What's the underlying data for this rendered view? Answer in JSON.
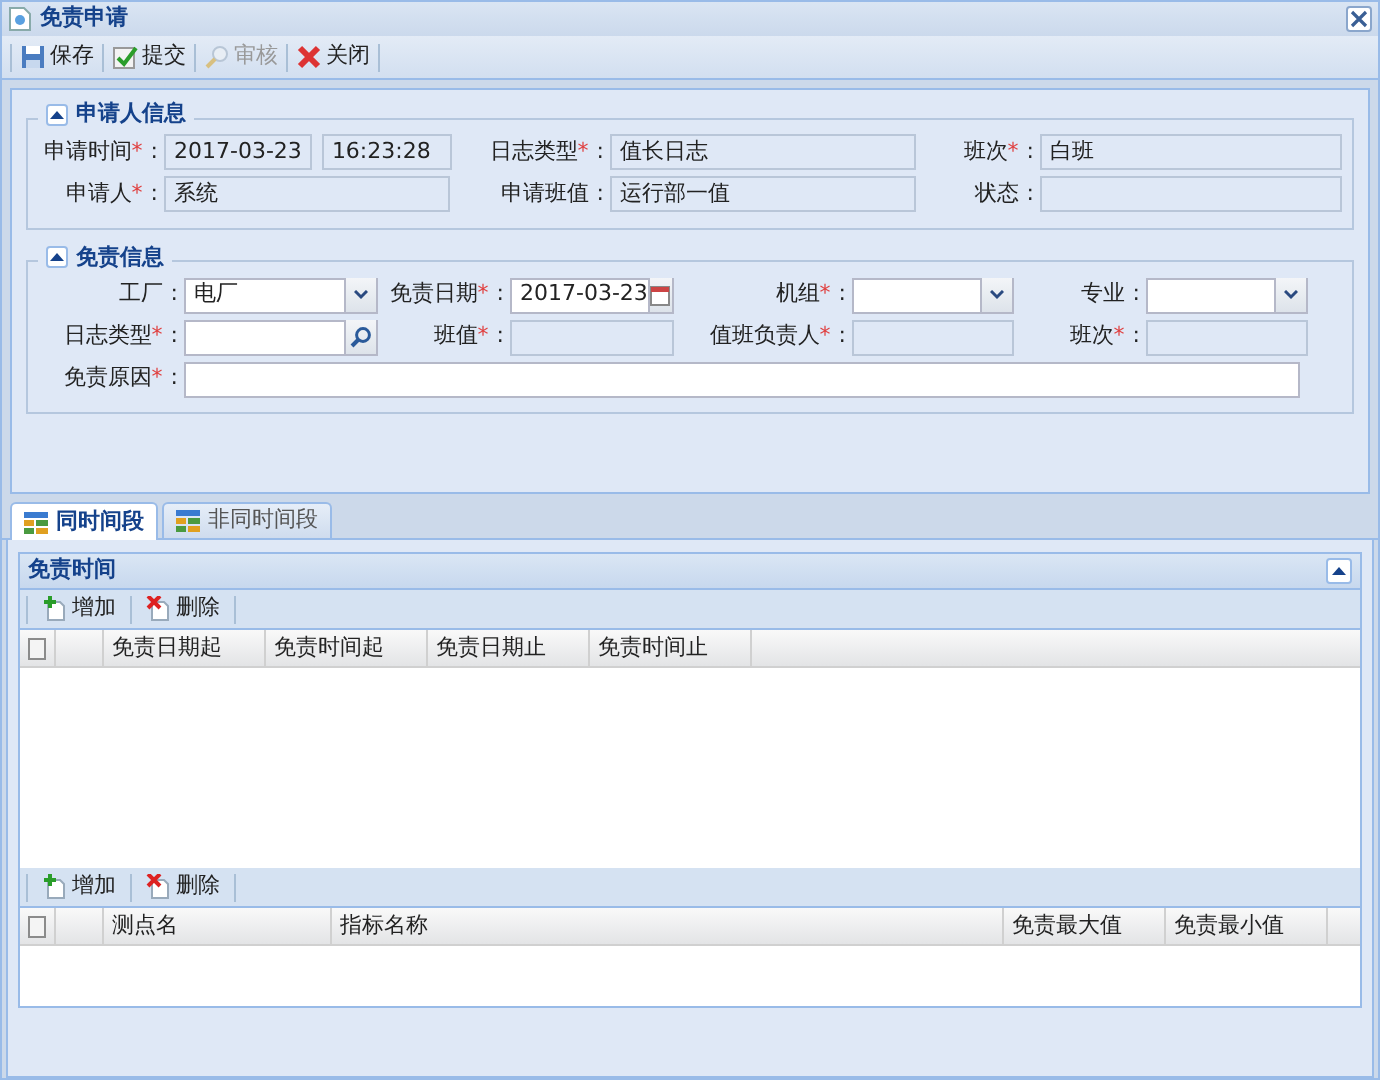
{
  "window": {
    "title": "免责申请"
  },
  "toolbar": [
    {
      "label": "保存",
      "kind": "save",
      "disabled": false
    },
    {
      "label": "提交",
      "kind": "submit",
      "disabled": false
    },
    {
      "label": "审核",
      "kind": "review",
      "disabled": true
    },
    {
      "label": "关闭",
      "kind": "close",
      "disabled": false
    }
  ],
  "applicant": {
    "title": "申请人信息",
    "rows": [
      [
        {
          "label": "申请时间",
          "star": "*",
          "colon": ":",
          "kind": "pair",
          "values": [
            "2017-03-23",
            "16:23:28"
          ],
          "readonly": true
        },
        {
          "label": "日志类型",
          "star": "*",
          "colon": ":",
          "kind": "text",
          "value": "值长日志",
          "readonly": true
        },
        {
          "label": "班次",
          "star": "*",
          "colon": ":",
          "kind": "text",
          "value": "白班",
          "readonly": true
        }
      ],
      [
        {
          "label": "申请人",
          "star": "*",
          "colon": ":",
          "kind": "text",
          "value": "系统",
          "readonly": true
        },
        {
          "label": "申请班值",
          "colon": ":",
          "kind": "text",
          "value": "运行部一值",
          "readonly": true
        },
        {
          "label": "状态",
          "colon": ":",
          "kind": "text",
          "readonly": true
        }
      ]
    ]
  },
  "exemption": {
    "title": "免责信息",
    "rows": [
      [
        {
          "label": "工厂",
          "colon": ":",
          "kind": "combo",
          "value": "电厂",
          "readonly": false
        },
        {
          "label": "免责日期",
          "star": "*",
          "colon": ":",
          "kind": "date",
          "value": "2017-03-23",
          "readonly": false
        },
        {
          "label": "机组",
          "star": "*",
          "colon": ":",
          "kind": "combo",
          "readonly": false
        },
        {
          "label": "专业",
          "colon": ":",
          "kind": "combo",
          "readonly": false
        }
      ],
      [
        {
          "label": "日志类型",
          "star": "*",
          "colon": ":",
          "kind": "search",
          "readonly": false
        },
        {
          "label": "班值",
          "star": "*",
          "colon": ":",
          "kind": "text",
          "readonly": true
        },
        {
          "label": "值班负责人",
          "star": "*",
          "colon": ":",
          "kind": "text",
          "readonly": true
        },
        {
          "label": "班次",
          "star": "*",
          "colon": ":",
          "kind": "text",
          "readonly": true
        }
      ],
      [
        {
          "label": "免责原因",
          "star": "*",
          "colon": ":",
          "kind": "wide",
          "readonly": false
        }
      ]
    ]
  },
  "tabs": [
    {
      "label": "同时间段",
      "selected": true
    },
    {
      "label": "非同时间段",
      "selected": false
    }
  ],
  "panel": {
    "title": "免责时间",
    "expanded": true
  },
  "grids": [
    {
      "toolbar": [
        {
          "label": "增加",
          "kind": "add"
        },
        {
          "label": "删除",
          "kind": "delete"
        }
      ],
      "checked": false,
      "columns": [
        "免责日期起",
        "免责时间起",
        "免责日期止",
        "免责时间止"
      ],
      "kind": "time"
    },
    {
      "toolbar": [
        {
          "label": "增加",
          "kind": "add"
        },
        {
          "label": "删除",
          "kind": "delete"
        }
      ],
      "checked": false,
      "columns": [
        "测点名",
        "指标名称",
        "免责最大值",
        "免责最小值"
      ],
      "kind": "point"
    }
  ]
}
